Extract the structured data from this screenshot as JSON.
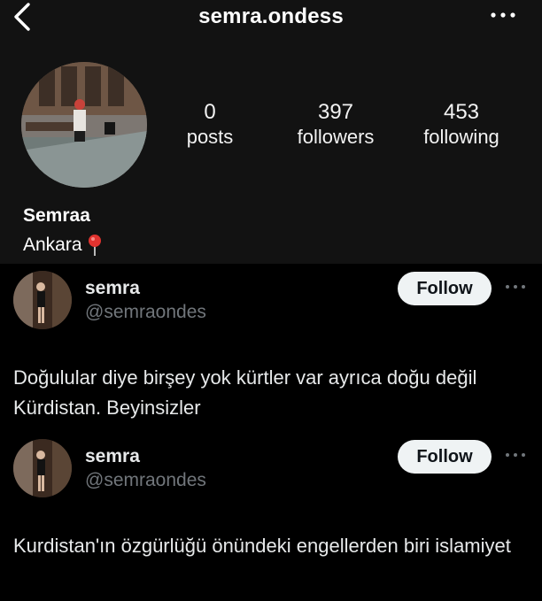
{
  "profile": {
    "username": "semra.ondess",
    "stats": [
      {
        "value": "0",
        "label": "posts"
      },
      {
        "value": "397",
        "label": "followers"
      },
      {
        "value": "453",
        "label": "following"
      }
    ],
    "display_name": "Semraa",
    "bio": "Ankara",
    "bio_icon": "round-pushpin-icon"
  },
  "tweets": [
    {
      "name": "semra",
      "handle": "@semraondes",
      "follow_label": "Follow",
      "text": "Doğulular diye birşey yok kürtler var ayrıca doğu değil Kürdistan.  Beyinsizler"
    },
    {
      "name": "semra",
      "handle": "@semraondes",
      "follow_label": "Follow",
      "text": "Kurdistan'ın  özgürlüğü önündeki engellerden biri islamiyet"
    }
  ],
  "colors": {
    "header_bg": "#121212",
    "feed_bg": "#000000",
    "handle_gray": "#71767b",
    "follow_bg": "#eff3f4",
    "pin_red": "#e0332f"
  }
}
